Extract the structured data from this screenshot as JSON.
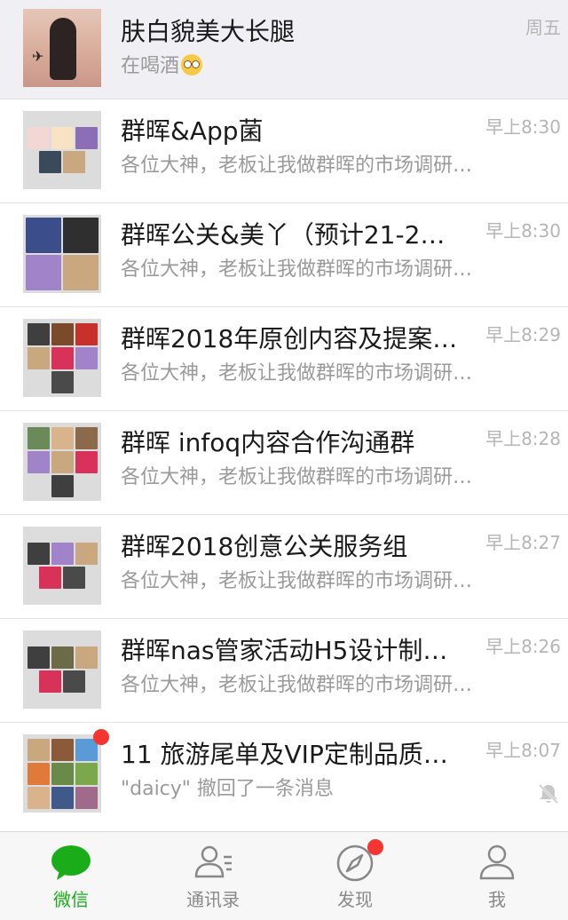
{
  "chats": [
    {
      "title": "肤白貌美大长腿",
      "preview": "在喝酒",
      "time": "周五",
      "pinned": true,
      "emoji": "flushed-face-emoji",
      "avatar": "solo"
    },
    {
      "title": "群晖&App菌",
      "preview": "各位大神，老板让我做群晖的市场调研…",
      "time": "早上8:30",
      "avatar_tiles": [
        "#f2d7d5",
        "#f7e3c4",
        "#8a6fb6",
        "#3b4a5a",
        "#c9a77f"
      ]
    },
    {
      "title": "群晖公关&美丫（预计21-25…",
      "preview": "各位大神，老板让我做群晖的市场调研…",
      "time": "早上8:30",
      "avatar_tiles": [
        "#3b4d8a",
        "#2f2f2f",
        "#a183c9",
        "#c9a77f"
      ]
    },
    {
      "title": "群晖2018年原创内容及提案…",
      "preview": "各位大神，老板让我做群晖的市场调研…",
      "time": "早上8:29",
      "avatar_tiles": [
        "#3f3f3f",
        "#7a4a2a",
        "#c8312a",
        "#c9a77f",
        "#d8325a",
        "#a183c9",
        "#4a4a4a"
      ]
    },
    {
      "title": "群晖 infoq内容合作沟通群",
      "preview": "各位大神，老板让我做群晖的市场调研…",
      "time": "早上8:28",
      "avatar_tiles": [
        "#6b8a5a",
        "#d9b38c",
        "#8a6a4a",
        "#a183c9",
        "#c9a77f",
        "#d8325a",
        "#3f3f3f"
      ]
    },
    {
      "title": "群晖2018创意公关服务组",
      "preview": "各位大神，老板让我做群晖的市场调研…",
      "time": "早上8:27",
      "avatar_tiles": [
        "#3f3f3f",
        "#a183c9",
        "#c9a77f",
        "#d8325a",
        "#4a4a4a"
      ]
    },
    {
      "title": "群晖nas管家活动H5设计制…",
      "preview": "各位大神，老板让我做群晖的市场调研…",
      "time": "早上8:26",
      "avatar_tiles": [
        "#3f3f3f",
        "#6b6b4a",
        "#c9a77f",
        "#d8325a",
        "#4a4a4a"
      ]
    },
    {
      "title": "11 旅游尾单及VIP定制品质…",
      "preview": "\"daicy\" 撤回了一条消息",
      "time": "早上8:07",
      "unread": true,
      "muted": true,
      "avatar_tiles": [
        "#c9a77f",
        "#8a5a3a",
        "#5a9ad6",
        "#e07a3a",
        "#6a8a4a",
        "#7aa84a",
        "#d9b38c",
        "#3f5a8a",
        "#a06a8a"
      ]
    }
  ],
  "tabbar": {
    "tabs": [
      {
        "label": "微信",
        "icon": "chat-bubble-icon",
        "active": true
      },
      {
        "label": "通讯录",
        "icon": "contacts-icon"
      },
      {
        "label": "发现",
        "icon": "compass-icon",
        "badge": true
      },
      {
        "label": "我",
        "icon": "person-icon"
      }
    ]
  },
  "colors": {
    "accent": "#1aad19",
    "badge": "#f43530",
    "pinned_bg": "#f0f0f4"
  }
}
